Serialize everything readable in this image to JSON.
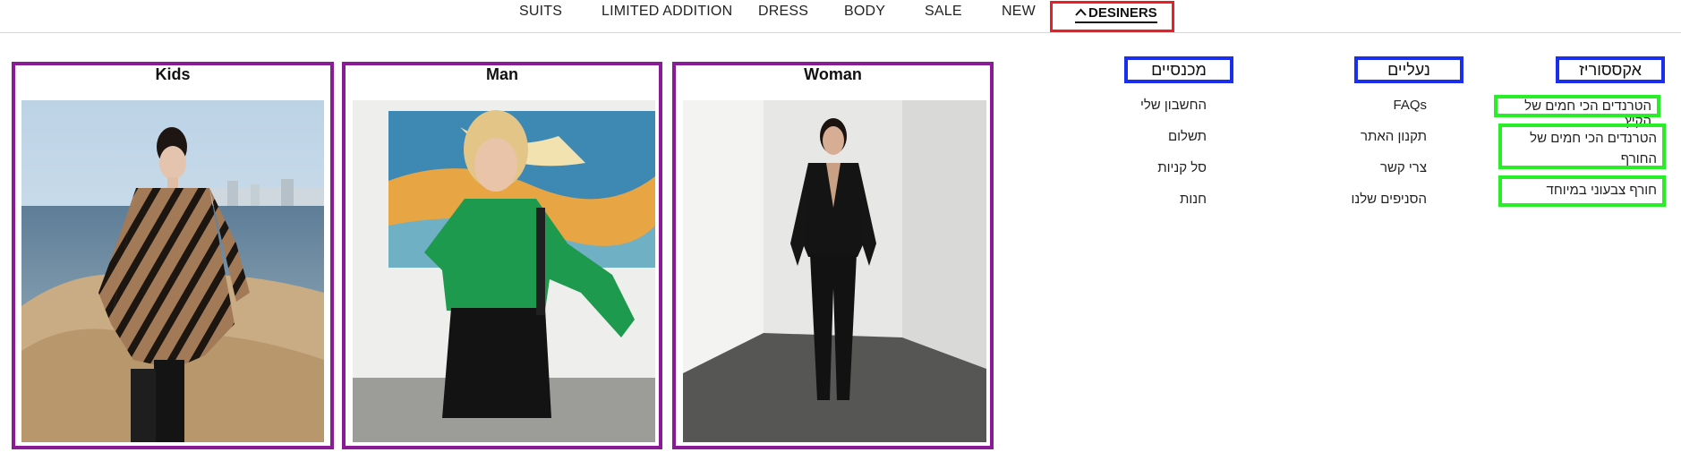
{
  "nav": {
    "items": [
      "SUITS",
      "LIMITED ADDITION",
      "DRESS",
      "BODY",
      "SALE",
      "NEW"
    ],
    "active": "DESINERS"
  },
  "cards": [
    {
      "title": "Kids"
    },
    {
      "title": "Man"
    },
    {
      "title": "Woman"
    }
  ],
  "columns": {
    "accessories": {
      "heading": "אקססוריז",
      "links": [
        "הטרנדים הכי חמים של הקיץ",
        "הטרנדים הכי חמים של החורף",
        "חורף צבעוני במיוחד"
      ]
    },
    "shoes": {
      "heading": "נעליים",
      "links": [
        "FAQs",
        "תקנון האתר",
        "צרי קשר",
        "הסניפים שלנו"
      ]
    },
    "pants": {
      "heading": "מכנסיים",
      "links": [
        "החשבון שלי",
        "תשלום",
        "סל קניות",
        "חנות"
      ]
    }
  },
  "colors": {
    "active_highlight": "#ee1c24",
    "card_border": "#8a1b96",
    "heading_border": "#1a2ef0",
    "link_border": "#27ee27"
  }
}
